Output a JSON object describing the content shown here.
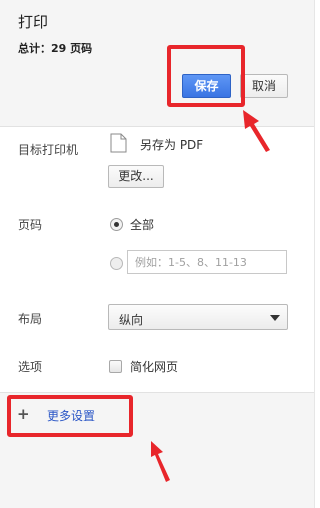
{
  "header": {
    "title": "打印",
    "total_label": "总计：",
    "total_value": "29 页码"
  },
  "buttons": {
    "save": "保存",
    "cancel": "取消",
    "change": "更改..."
  },
  "destination": {
    "label": "目标打印机",
    "name": "另存为 PDF",
    "icon": "file-icon"
  },
  "pages": {
    "label": "页码",
    "option_all": "全部",
    "option_all_selected": true,
    "custom_placeholder": "例如：1-5、8、11-13"
  },
  "layout": {
    "label": "布局",
    "selected": "纵向"
  },
  "options": {
    "label": "选项",
    "simplify_label": "简化网页",
    "simplify_checked": false
  },
  "more_settings": {
    "icon": "plus-icon",
    "label": "更多设置"
  },
  "colors": {
    "annotation_red": "#e8262b",
    "save_blue": "#3974e3",
    "link_blue": "#2a56c6"
  }
}
